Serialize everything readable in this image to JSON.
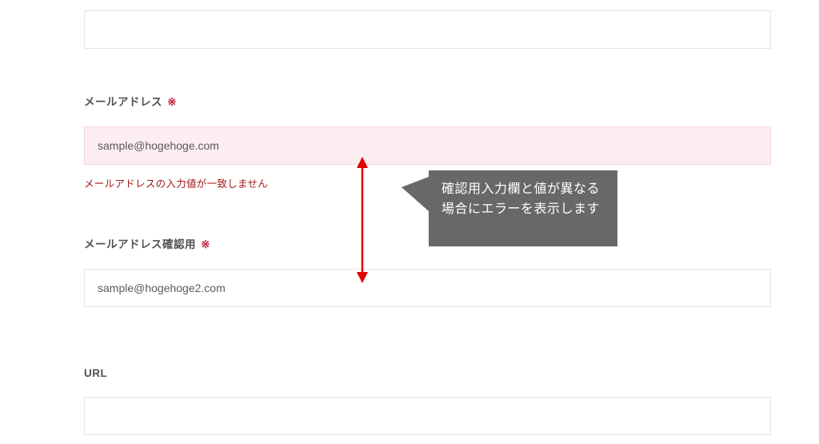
{
  "top_box": {
    "value": ""
  },
  "email": {
    "label": "メールアドレス",
    "required_mark": "※",
    "value": "sample@hogehoge.com",
    "error": "メールアドレスの入力値が一致しません"
  },
  "email_confirm": {
    "label": "メールアドレス確認用",
    "required_mark": "※",
    "value": "sample@hogehoge2.com"
  },
  "url": {
    "label": "URL",
    "value": ""
  },
  "callout": {
    "text": "確認用入力欄と値が異なる場合にエラーを表示します"
  }
}
